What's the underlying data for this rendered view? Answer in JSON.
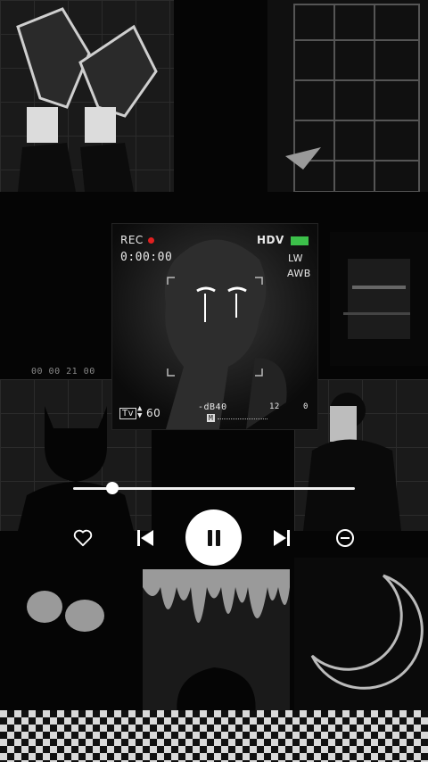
{
  "player": {
    "viewfinder": {
      "rec": "REC",
      "timecode": "0:00:00",
      "hdv": "HDV",
      "lw": "LW",
      "awb": "AWB",
      "tv": "Tv",
      "shutter": "60",
      "db": "-dB40",
      "m": "M",
      "level_12": "12",
      "level_0": "0"
    },
    "counter": "00 00 21 00",
    "progress_fraction": 0.14,
    "accent": "#ffffff",
    "rec_color": "#e02020",
    "battery_color": "#3cc04a"
  },
  "controls": {
    "like": "heart-icon",
    "previous": "skip-previous-icon",
    "play_pause": "pause-icon",
    "next": "skip-next-icon",
    "remove": "minus-circle-icon"
  }
}
